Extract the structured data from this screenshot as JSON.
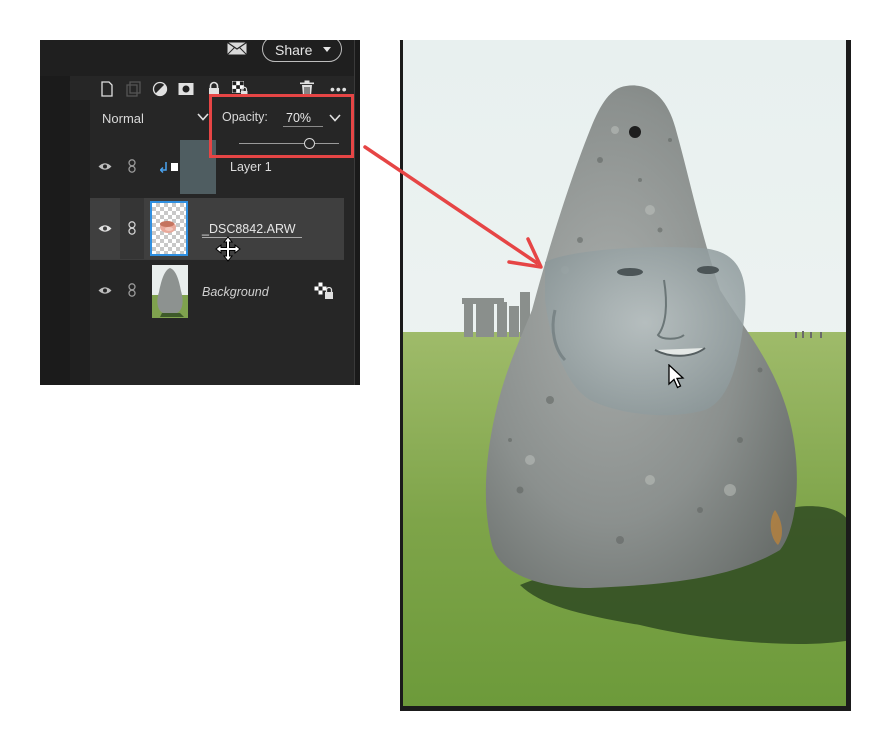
{
  "header": {
    "share_label": "Share"
  },
  "toolbar": {
    "icons": [
      "new-layer-icon",
      "duplicate-layer-icon",
      "adjustment-layer-icon",
      "layer-mask-icon",
      "lock-icon",
      "transparency-lock-icon",
      "trash-icon",
      "more-options-icon"
    ]
  },
  "blend_mode": {
    "value": "Normal"
  },
  "opacity": {
    "label": "Opacity:",
    "value": "70%",
    "level": 0.7
  },
  "layers": [
    {
      "name": "Layer 1",
      "visible": true,
      "clipped": true
    },
    {
      "name": "_DSC8842.ARW",
      "visible": true,
      "selected": true
    },
    {
      "name": "Background",
      "visible": true,
      "locked": true
    }
  ],
  "colors": {
    "highlight": "#e64545",
    "panel_bg": "#262626",
    "selection_border": "#2f8fe0"
  }
}
